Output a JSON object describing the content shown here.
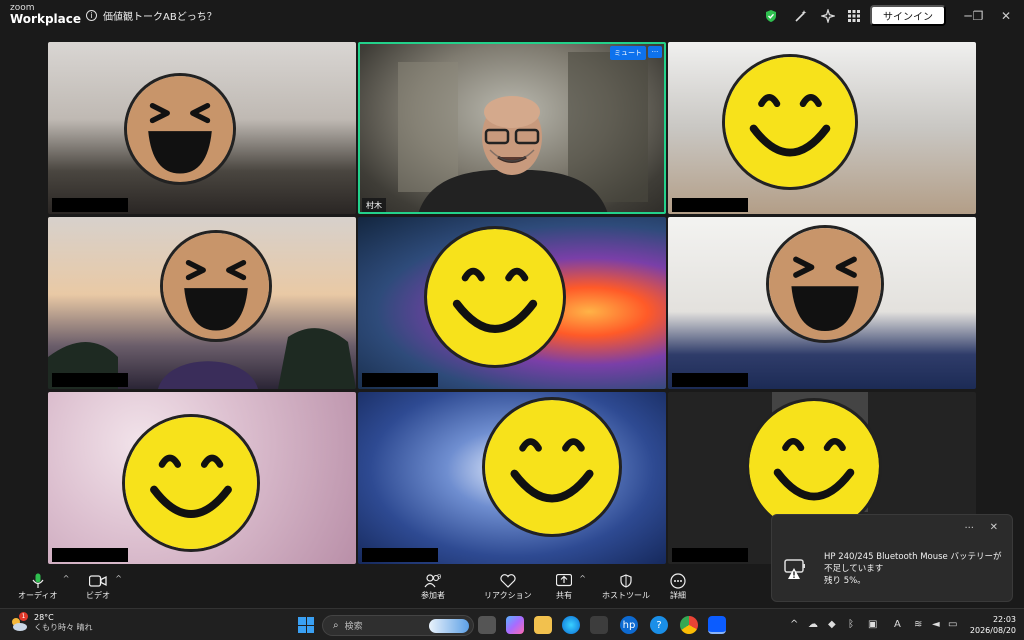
{
  "window": {
    "logo_top": "zoom",
    "logo_bottom": "Workplace",
    "meeting_title": "価値観トークABどっち？",
    "signin_label": "サインイン"
  },
  "tiles": [
    {
      "id": "p1",
      "emoji": "laugh",
      "name": ""
    },
    {
      "id": "p2",
      "emoji": "none",
      "name": "村木",
      "speaking": true,
      "mute_label": "ミュート",
      "more_label": "···"
    },
    {
      "id": "p3",
      "emoji": "smile",
      "name": ""
    },
    {
      "id": "p4",
      "emoji": "laugh",
      "name": ""
    },
    {
      "id": "p5",
      "emoji": "smile",
      "name": ""
    },
    {
      "id": "p6",
      "emoji": "laugh",
      "name": ""
    },
    {
      "id": "p7",
      "emoji": "smile",
      "name": ""
    },
    {
      "id": "p8",
      "emoji": "smile",
      "name": ""
    },
    {
      "id": "p9",
      "emoji": "smile",
      "name": ""
    }
  ],
  "toolbar": {
    "audio_label": "オーディオ",
    "video_label": "ビデオ",
    "participants_label": "参加者",
    "participants_count": "9",
    "reactions_label": "リアクション",
    "share_label": "共有",
    "host_tools_label": "ホストツール",
    "more_label": "詳細"
  },
  "notification": {
    "text": "HP 240/245 Bluetooth Mouse バッテリーが不足しています",
    "sub": "残り 5%。",
    "dots": "···",
    "close": "✕"
  },
  "taskbar": {
    "weather_badge": "1",
    "temperature": "28°C",
    "condition": "くもり時々 晴れ",
    "search_placeholder": "検索",
    "time": "22:03",
    "date": "2026/08/20"
  },
  "colors": {
    "speaking_border": "#23d18b",
    "accent": "#0e72ed",
    "emoji_yellow": "#f7e21b",
    "emoji_tan": "#c8956a"
  }
}
